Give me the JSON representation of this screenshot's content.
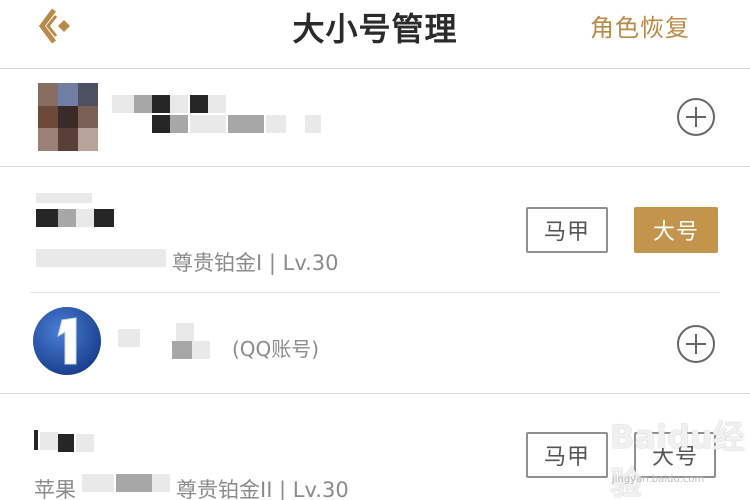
{
  "header": {
    "back_icon": "back-diamond-icon",
    "title": "大小号管理",
    "action_label": "角色恢复",
    "accent_color": "#b98a48"
  },
  "accounts": [
    {
      "meta": "",
      "action_icon": "plus-circle-icon"
    },
    {
      "meta": "尊贵铂金I | Lv.30",
      "buttons": {
        "alt_label": "马甲",
        "main_label": "大号"
      }
    },
    {
      "suffix": "(QQ账号)",
      "action_icon": "plus-circle-icon"
    },
    {
      "meta_prefix": "苹果",
      "meta": "尊贵铂金II | Lv.30",
      "buttons": {
        "alt_label": "马甲",
        "main_label": "大号"
      }
    }
  ],
  "colors": {
    "primary_button": "#c2944c",
    "outline_button": "#8f8f8f"
  },
  "watermark": {
    "text": "Baidu经验",
    "sub": "jingyan.baidu.com"
  }
}
